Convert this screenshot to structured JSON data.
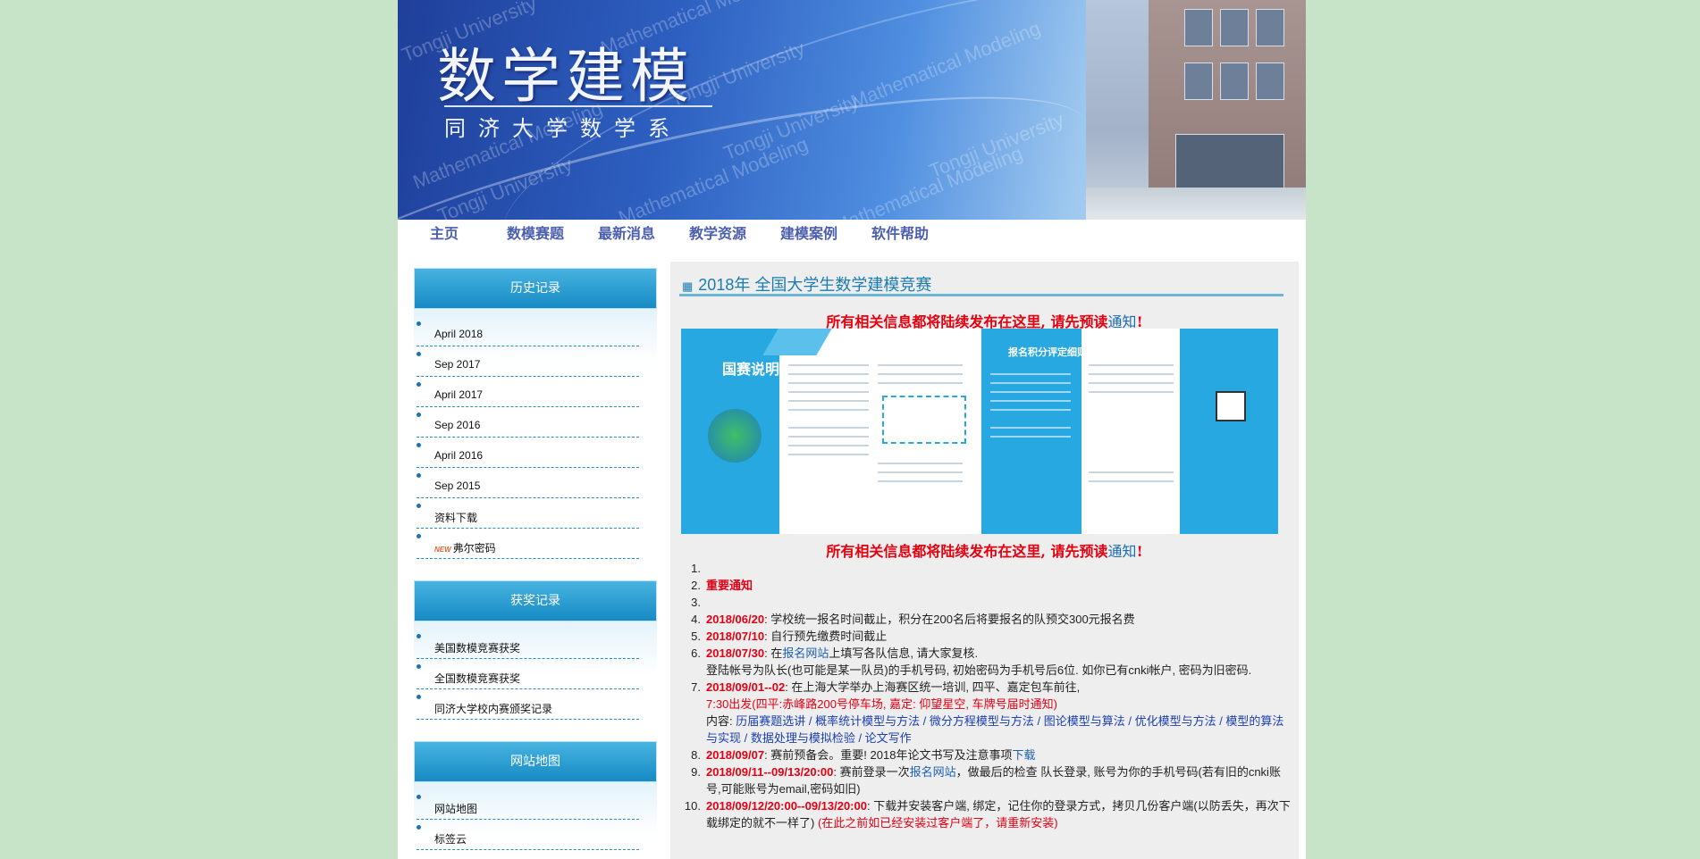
{
  "banner": {
    "title": "数学建模",
    "subtitle": "同济大学数学系",
    "watermark": [
      "Tongji University",
      "Mathematical Modeling"
    ]
  },
  "nav": [
    "主页",
    "数模赛题",
    "最新消息",
    "教学资源",
    "建模案例",
    "软件帮助"
  ],
  "sidebar": {
    "history": {
      "title": "历史记录",
      "items": [
        "April 2018",
        "Sep 2017",
        "April 2017",
        "Sep 2016",
        "April 2016",
        "Sep 2015",
        "资料下载",
        "弗尔密码"
      ],
      "new_badge": "NEW"
    },
    "awards": {
      "title": "获奖记录",
      "items": [
        "美国数模竞赛获奖",
        "全国数模竞赛获奖",
        "同济大学校内赛颁奖记录"
      ]
    },
    "sitemap": {
      "title": "网站地图",
      "items": [
        "网站地图",
        "标签云"
      ]
    }
  },
  "main": {
    "title": "2018年 全国大学生数学建模竞赛",
    "notice_prefix": "所有相关信息都将陆续发布在这里, 请先预读",
    "notice_link": "通知",
    "notice_suffix": "!",
    "poster": {
      "left_heading": "国赛说明",
      "right_heading": "报名积分评定细则"
    },
    "list": [
      {
        "num": "1.",
        "parts": []
      },
      {
        "num": "2.",
        "parts": [
          {
            "t": "重要通知",
            "c": "date"
          }
        ]
      },
      {
        "num": "3.",
        "parts": []
      },
      {
        "num": "4.",
        "parts": [
          {
            "t": "2018/06/20",
            "c": "date"
          },
          {
            "t": ": 学校统一报名时间截止，积分在200名后将要报名的队预交300元报名费",
            "c": ""
          }
        ]
      },
      {
        "num": "5.",
        "parts": [
          {
            "t": "2018/07/10",
            "c": "date"
          },
          {
            "t": ": 自行预先缴费时间截止",
            "c": ""
          }
        ]
      },
      {
        "num": "6.",
        "parts": [
          {
            "t": "2018/07/30",
            "c": "date"
          },
          {
            "t": ": 在",
            "c": ""
          },
          {
            "t": "报名网站",
            "c": "blue"
          },
          {
            "t": "上填写各队信息, 请大家复核.",
            "c": ""
          },
          {
            "t": "\n登陆帐号为队长(也可能是某一队员)的手机号码, 初始密码为手机号后6位. 如你已有cnki帐户, 密码为旧密码.",
            "c": ""
          }
        ]
      },
      {
        "num": "7.",
        "parts": [
          {
            "t": "2018/09/01--02",
            "c": "date"
          },
          {
            "t": ": 在上海大学举办上海赛区统一培训, 四平、嘉定包车前往,",
            "c": ""
          },
          {
            "t": "\n7:30出发(四平:赤峰路200号停车场, 嘉定: 仰望星空, 车牌号届时通知)",
            "c": "red"
          },
          {
            "t": "\n内容: ",
            "c": ""
          },
          {
            "t": "历届赛题选讲 / 概率统计模型与方法 / 微分方程模型与方法 / 图论模型与算法 / 优化模型与方法 / 模型的算法与实现 / 数据处理与模拟检验 / 论文写作",
            "c": "dblue"
          }
        ]
      },
      {
        "num": "8.",
        "parts": [
          {
            "t": "2018/09/07",
            "c": "date"
          },
          {
            "t": ": 赛前预备会。重要! 2018年论文书写及注意事项",
            "c": ""
          },
          {
            "t": "下载",
            "c": "blue"
          }
        ]
      },
      {
        "num": "9.",
        "parts": [
          {
            "t": "2018/09/11--09/13/20:00",
            "c": "date"
          },
          {
            "t": ": 赛前登录一次",
            "c": ""
          },
          {
            "t": "报名网站",
            "c": "blue"
          },
          {
            "t": "，做最后的检查 队长登录, 账号为你的手机号码(若有旧的cnki账号,可能账号为email,密码如旧)",
            "c": ""
          }
        ]
      },
      {
        "num": "10.",
        "parts": [
          {
            "t": "2018/09/12/20:00--09/13/20:00",
            "c": "date"
          },
          {
            "t": ": 下载并安装客户端, 绑定，记住你的登录方式，拷贝几份客户端(以防丢失，再次下载绑定的就不一样了) ",
            "c": ""
          },
          {
            "t": "(在此之前如已经安装过客户端了，请重新安装)",
            "c": "red"
          }
        ]
      }
    ]
  }
}
